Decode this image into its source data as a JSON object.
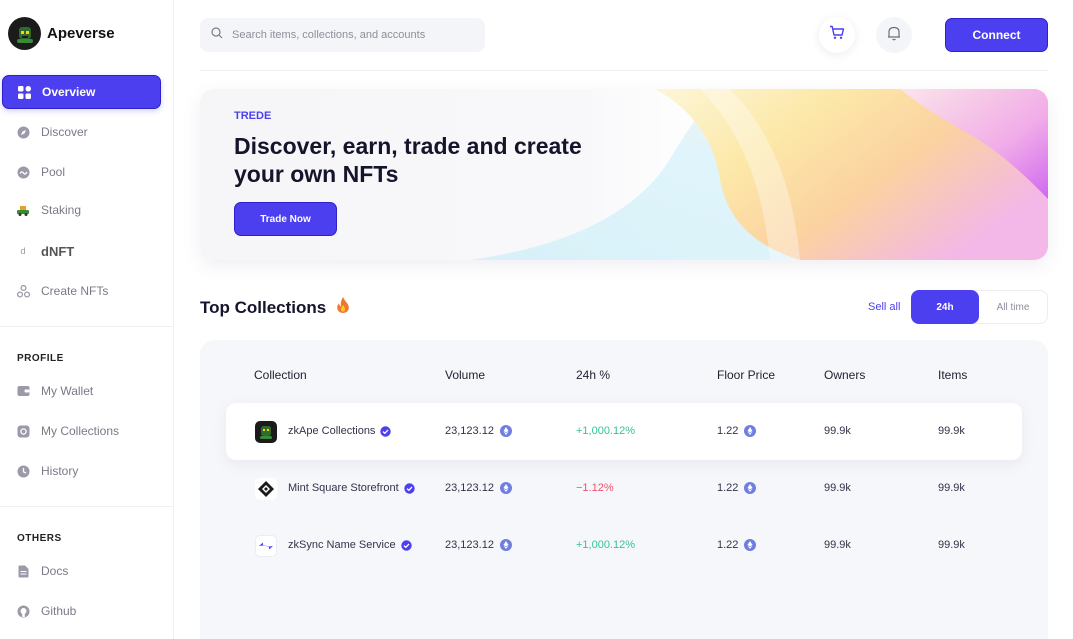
{
  "brand": {
    "name": "Apeverse"
  },
  "sidebar": {
    "items": [
      {
        "label": "Overview",
        "icon": "grid-icon",
        "active": true
      },
      {
        "label": "Discover",
        "icon": "compass-icon"
      },
      {
        "label": "Pool",
        "icon": "pool-icon"
      },
      {
        "label": "Staking",
        "icon": "staking-icon"
      },
      {
        "label": "dNFT",
        "icon": "dnft-icon"
      },
      {
        "label": "Create NFTs",
        "icon": "create-icon"
      }
    ],
    "profile_title": "PROFILE",
    "profile_items": [
      {
        "label": "My Wallet",
        "icon": "wallet-icon"
      },
      {
        "label": "My Collections",
        "icon": "collections-icon"
      },
      {
        "label": "History",
        "icon": "clock-icon"
      }
    ],
    "others_title": "OTHERS",
    "others_items": [
      {
        "label": "Docs",
        "icon": "docs-icon"
      },
      {
        "label": "Github",
        "icon": "github-icon"
      }
    ]
  },
  "header": {
    "search_placeholder": "Search items, collections, and accounts",
    "connect_label": "Connect"
  },
  "banner": {
    "tag": "TREDE",
    "title": "Discover, earn, trade and create your own NFTs",
    "button_label": "Trade Now"
  },
  "top_collections": {
    "title": "Top Collections",
    "sell_all": "Sell all",
    "filter_24h": "24h",
    "filter_all": "All time",
    "columns": [
      "Collection",
      "Volume",
      "24h %",
      "Floor Price",
      "Owners",
      "Items"
    ],
    "rows": [
      {
        "name": "zkApe Collections",
        "volume": "23,123.12",
        "change": "+1,000.12%",
        "trend": "up",
        "floor": "1.22",
        "owners": "99.9k",
        "items": "99.9k"
      },
      {
        "name": "Mint Square Storefront",
        "volume": "23,123.12",
        "change": "−1.12%",
        "trend": "down",
        "floor": "1.22",
        "owners": "99.9k",
        "items": "99.9k"
      },
      {
        "name": "zkSync Name Service",
        "volume": "23,123.12",
        "change": "+1,000.12%",
        "trend": "up",
        "floor": "1.22",
        "owners": "99.9k",
        "items": "99.9k"
      }
    ]
  },
  "colors": {
    "accent": "#4b3ff0",
    "positive": "#36c29a",
    "negative": "#f0506e"
  }
}
